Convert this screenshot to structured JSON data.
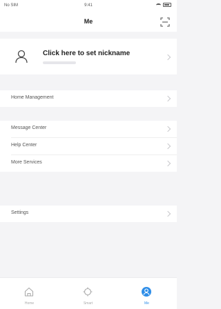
{
  "status_bar": {
    "carrier": "No SIM",
    "time": "9:41"
  },
  "nav": {
    "title": "Me"
  },
  "profile": {
    "nickname_prompt": "Click here to set nickname"
  },
  "menu_sections": [
    {
      "items": [
        {
          "label": "Home Management"
        }
      ]
    },
    {
      "items": [
        {
          "label": "Message Center"
        },
        {
          "label": "Help Center"
        },
        {
          "label": "More Services"
        }
      ]
    },
    {
      "items": [
        {
          "label": "Settings"
        }
      ]
    }
  ],
  "tabs": [
    {
      "label": "Home",
      "icon": "home-icon",
      "active": false
    },
    {
      "label": "Smart",
      "icon": "smart-icon",
      "active": false
    },
    {
      "label": "Me",
      "icon": "profile-icon",
      "active": true
    }
  ],
  "colors": {
    "accent": "#2f8ee8",
    "background": "#f4f4f6"
  }
}
